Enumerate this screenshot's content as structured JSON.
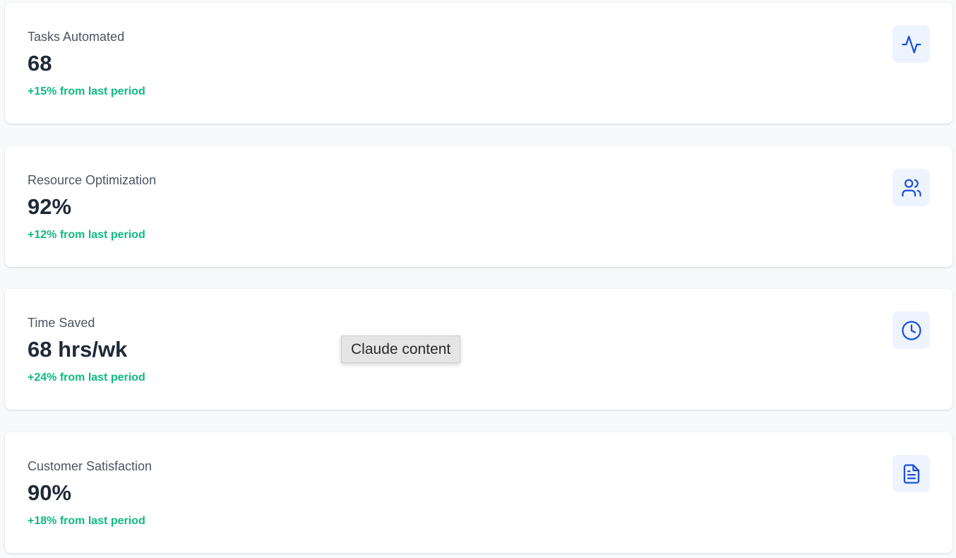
{
  "colors": {
    "positive": "#10b981",
    "icon": "#1d4ed8",
    "icon_bg": "#eef4ff"
  },
  "metrics": [
    {
      "label": "Tasks Automated",
      "value": "68",
      "change": "+15% from last period",
      "icon": "activity-icon"
    },
    {
      "label": "Resource Optimization",
      "value": "92%",
      "change": "+12% from last period",
      "icon": "users-icon"
    },
    {
      "label": "Time Saved",
      "value": "68 hrs/wk",
      "change": "+24% from last period",
      "icon": "clock-icon"
    },
    {
      "label": "Customer Satisfaction",
      "value": "90%",
      "change": "+18% from last period",
      "icon": "file-text-icon"
    }
  ],
  "tooltip": {
    "text": "Claude content"
  }
}
